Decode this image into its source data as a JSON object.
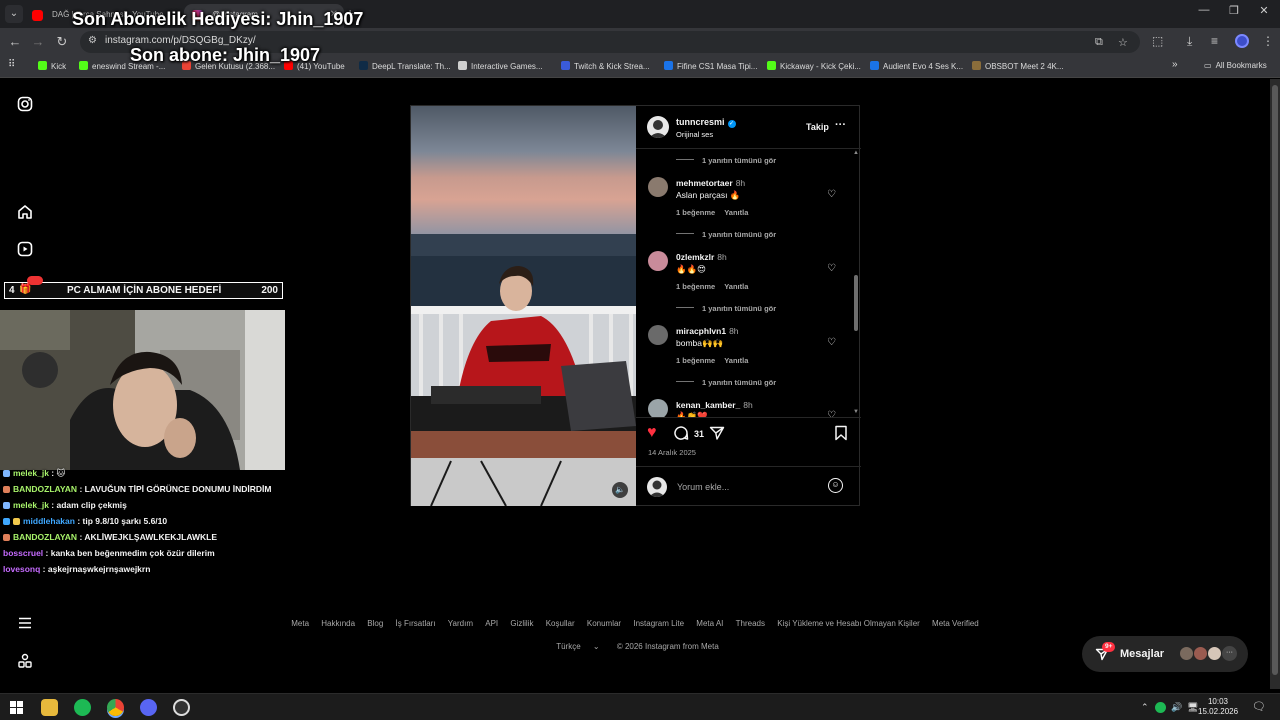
{
  "browser": {
    "tabs": [
      {
        "title": "DAĞ | Fırça Sahnesi - YouTube",
        "active": false
      },
      {
        "title": "@ Instagram",
        "active": true
      }
    ],
    "new_tab": "+",
    "url": "instagram.com/p/DSQGBg_DKzy/",
    "bookmarks": [
      "Kick",
      "eneswind Stream -...",
      "Gelen Kutusu (2.368...",
      "(41) YouTube",
      "DeepL Translate: Th...",
      "Interactive Games...",
      "Twitch & Kick Strea...",
      "Fifine CS1 Masa Tipi...",
      "Kickaway - Kick Çeki...",
      "Audient Evo 4 Ses K...",
      "OBSBOT Meet 2 4K..."
    ],
    "all_bookmarks": "All Bookmarks",
    "more_bookmarks": "»"
  },
  "overlay": {
    "last_gift": "Son Abonelik Hediyesi: Jhin_1907",
    "last_sub": "Son abone: Jhin_1907",
    "goal": {
      "current": "4",
      "title": "PC ALMAM İÇİN ABONE HEDEFİ",
      "target": "200"
    }
  },
  "chat": [
    {
      "user": "melek_jk",
      "message": "",
      "color": "#a7f26a"
    },
    {
      "user": "BANDOZLAYAN",
      "message": "LAVUĞUN TİPİ GÖRÜNCE DONUMU İNDİRDİM",
      "color": "#a7f26a"
    },
    {
      "user": "melek_jk",
      "message": "adam clip çekmiş",
      "color": "#a7f26a"
    },
    {
      "user": "middlehakan",
      "message": "tip 9.8/10 şarkı 5.6/10",
      "color": "#3fa8ff"
    },
    {
      "user": "BANDOZLAYAN",
      "message": "AKLİWEJKLŞAWLKEKJLAWKLE",
      "color": "#a7f26a"
    },
    {
      "user": "bosscruel",
      "message": "kanka ben beğenmedim çok özür dilerim",
      "color": "#c66bff"
    },
    {
      "user": "lovesonq",
      "message": "aşkejrnaşwkejrnşawejkrn",
      "color": "#c66bff"
    }
  ],
  "post": {
    "author": "tunncresmi",
    "audio": "Orijinal ses",
    "follow_label": "Takip",
    "more_label": "···",
    "comments": [
      {
        "user": "mehmetortaer",
        "time": "8h",
        "text": "Aslan parçası 🔥",
        "likes": "1 beğenme",
        "reply": "Yanıtla"
      },
      {
        "user": "0zlemkzlr",
        "time": "8h",
        "text": "🔥🔥😍",
        "likes": "1 beğenme",
        "reply": "Yanıtla"
      },
      {
        "user": "miracphlvn1",
        "time": "8h",
        "text": "bomba🙌🙌",
        "likes": "1 beğenme",
        "reply": "Yanıtla"
      },
      {
        "user": "kenan_kamber_",
        "time": "8h",
        "text": "🔥👏❤️",
        "likes": "",
        "reply": ""
      }
    ],
    "view_replies": "1 yanıtın tümünü gör",
    "comment_count": "31",
    "date": "14 Aralık 2025",
    "comment_placeholder": "Yorum ekle..."
  },
  "footer": {
    "links": [
      "Meta",
      "Hakkında",
      "Blog",
      "İş Fırsatları",
      "Yardım",
      "API",
      "Gizlilik",
      "Koşullar",
      "Konumlar",
      "Instagram Lite",
      "Meta AI",
      "Threads",
      "Kişi Yükleme ve Hesabı Olmayan Kişiler",
      "Meta Verified"
    ],
    "language": "Türkçe",
    "copyright": "© 2026 Instagram from Meta"
  },
  "messages": {
    "label": "Mesajlar",
    "badge": "9+"
  },
  "taskbar": {
    "time": "10:03",
    "date": "15.02.2026"
  }
}
